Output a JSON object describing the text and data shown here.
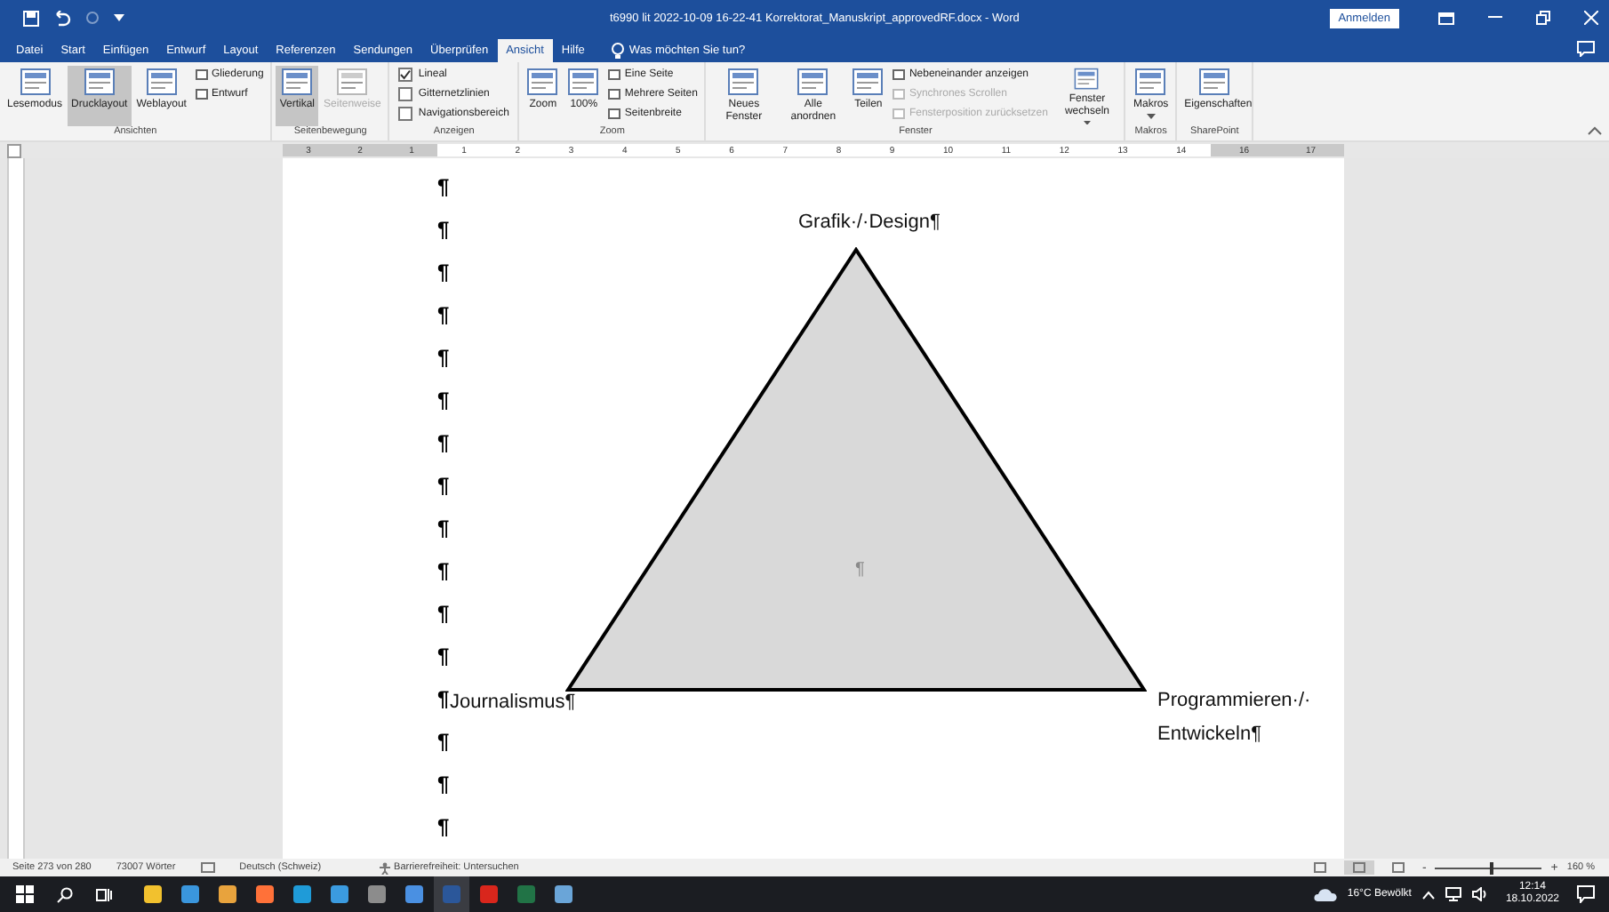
{
  "title_bar": {
    "title": "t6990 lit 2022-10-09 16-22-41 Korrektorat_Manuskript_approvedRF.docx  -  Word",
    "sign_in": "Anmelden"
  },
  "tabs": [
    {
      "label": "Datei",
      "selected": false
    },
    {
      "label": "Start",
      "selected": false
    },
    {
      "label": "Einfügen",
      "selected": false
    },
    {
      "label": "Entwurf",
      "selected": false
    },
    {
      "label": "Layout",
      "selected": false
    },
    {
      "label": "Referenzen",
      "selected": false
    },
    {
      "label": "Sendungen",
      "selected": false
    },
    {
      "label": "Überprüfen",
      "selected": false
    },
    {
      "label": "Ansicht",
      "selected": true
    },
    {
      "label": "Hilfe",
      "selected": false
    }
  ],
  "tell_me": {
    "placeholder": "Was möchten Sie tun?"
  },
  "ribbon_groups": [
    {
      "label": "Ansichten",
      "columns": [
        [
          {
            "kind": "large",
            "label": "Lesemodus",
            "selected": false,
            "disabled": false
          }
        ],
        [
          {
            "kind": "large",
            "label": "Drucklayout",
            "selected": true,
            "disabled": false
          }
        ],
        [
          {
            "kind": "large",
            "label": "Weblayout",
            "selected": false,
            "disabled": false
          }
        ],
        [
          {
            "kind": "small",
            "label": "Gliederung",
            "selected": false,
            "disabled": false
          },
          {
            "kind": "small",
            "label": "Entwurf",
            "selected": false,
            "disabled": false
          }
        ]
      ]
    },
    {
      "label": "Seitenbewegung",
      "columns": [
        [
          {
            "kind": "large",
            "label": "Vertikal",
            "selected": true,
            "disabled": false
          }
        ],
        [
          {
            "kind": "large",
            "label": "Seitenweise",
            "selected": false,
            "disabled": true
          }
        ]
      ]
    },
    {
      "label": "Anzeigen",
      "columns": [
        [
          {
            "kind": "check",
            "label": "Lineal",
            "checked": true
          },
          {
            "kind": "check",
            "label": "Gitternetzlinien",
            "checked": false
          },
          {
            "kind": "check",
            "label": "Navigationsbereich",
            "checked": false
          }
        ]
      ]
    },
    {
      "label": "Zoom",
      "columns": [
        [
          {
            "kind": "large",
            "label": "Zoom",
            "selected": false,
            "disabled": false
          }
        ],
        [
          {
            "kind": "large",
            "label": "100%",
            "selected": false,
            "disabled": false
          }
        ],
        [
          {
            "kind": "small",
            "label": "Eine Seite",
            "selected": false,
            "disabled": false
          },
          {
            "kind": "small",
            "label": "Mehrere Seiten",
            "selected": false,
            "disabled": false
          },
          {
            "kind": "small",
            "label": "Seitenbreite",
            "selected": false,
            "disabled": false
          }
        ]
      ]
    },
    {
      "label": "Fenster",
      "columns": [
        [
          {
            "kind": "large",
            "label": "Neues Fenster",
            "selected": false,
            "disabled": false
          }
        ],
        [
          {
            "kind": "large",
            "label": "Alle anordnen",
            "selected": false,
            "disabled": false
          }
        ],
        [
          {
            "kind": "large",
            "label": "Teilen",
            "selected": false,
            "disabled": false
          }
        ],
        [
          {
            "kind": "small",
            "label": "Nebeneinander anzeigen",
            "selected": false,
            "disabled": false
          },
          {
            "kind": "small",
            "label": "Synchrones Scrollen",
            "selected": false,
            "disabled": true
          },
          {
            "kind": "small",
            "label": "Fensterposition zurücksetzen",
            "selected": false,
            "disabled": true
          }
        ],
        [
          {
            "kind": "large",
            "label": "Fenster wechseln",
            "selected": false,
            "disabled": false,
            "dropdown": true
          }
        ]
      ]
    },
    {
      "label": "Makros",
      "columns": [
        [
          {
            "kind": "large",
            "label": "Makros",
            "selected": false,
            "disabled": false,
            "dropdown": true
          }
        ]
      ]
    },
    {
      "label": "SharePoint",
      "columns": [
        [
          {
            "kind": "large",
            "label": "Eigenschaften",
            "selected": false,
            "disabled": false
          }
        ]
      ]
    }
  ],
  "ruler": {
    "left_numbers": [
      "3",
      "2",
      "1"
    ],
    "numbers": [
      "1",
      "2",
      "3",
      "4",
      "5",
      "6",
      "7",
      "8",
      "9",
      "10",
      "11",
      "12",
      "13",
      "14"
    ],
    "right_numbers": [
      "16",
      "17"
    ]
  },
  "paragraph_marks": [
    "¶",
    "¶",
    "¶",
    "¶",
    "¶",
    "¶",
    "¶",
    "¶",
    "¶",
    "¶",
    "¶",
    "¶",
    "¶",
    "¶",
    "¶",
    "¶"
  ],
  "diagram": {
    "top_label": "Grafik·/·Design¶",
    "left_label": "Journalismus¶",
    "right_label_lines": [
      "Programmieren·/·",
      "Entwickeln¶"
    ],
    "center_mark": "¶"
  },
  "status_bar": {
    "page": "Seite 273 von 280",
    "words": "73007 Wörter",
    "language": "Deutsch (Schweiz)",
    "accessibility": "Barrierefreiheit: Untersuchen",
    "views": [
      {
        "selected": false
      },
      {
        "selected": true
      },
      {
        "selected": false
      }
    ],
    "zoom": {
      "level": 0.52,
      "minus": "-",
      "plus": "+",
      "reading": "160 %"
    }
  },
  "taskbar": {
    "apps": [
      {
        "color": "#f2c12e",
        "selected": false
      },
      {
        "color": "#3a96dd",
        "selected": false
      },
      {
        "color": "#e8a33d",
        "selected": false
      },
      {
        "color": "#ff7139",
        "selected": false
      },
      {
        "color": "#1f9bd8",
        "selected": false
      },
      {
        "color": "#3b9be0",
        "selected": false
      },
      {
        "color": "#8c8c8c",
        "selected": false
      },
      {
        "color": "#4a90e2",
        "selected": false
      },
      {
        "color": "#2b579a",
        "selected": true
      },
      {
        "color": "#d9261c",
        "selected": false
      },
      {
        "color": "#217346",
        "selected": false
      },
      {
        "color": "#6aa5d8",
        "selected": false
      }
    ],
    "weather": "16°C  Bewölkt",
    "time": "12:14",
    "date": "18.10.2022"
  }
}
